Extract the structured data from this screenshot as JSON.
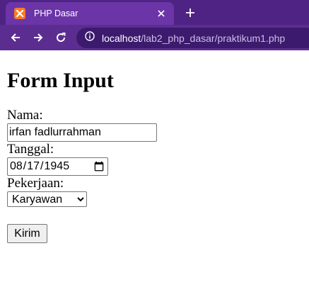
{
  "browser": {
    "tab_title": "PHP Dasar",
    "url_host": "localhost",
    "url_path": "/lab2_php_dasar/praktikum1.php"
  },
  "page": {
    "heading": "Form Input",
    "nama_label": "Nama:",
    "nama_value": "irfan fadlurrahman",
    "tanggal_label": "Tanggal:",
    "tanggal_value": "1945-08-17",
    "pekerjaan_label": "Pekerjaan:",
    "pekerjaan_selected": "Karyawan",
    "submit_label": "Kirim"
  }
}
